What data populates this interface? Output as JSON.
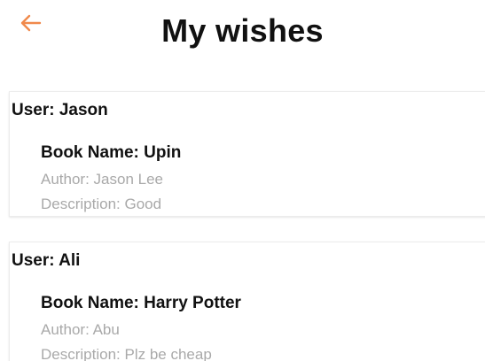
{
  "header": {
    "title": "My wishes",
    "back_icon": "arrow-left-icon",
    "accent_color": "#f0894b"
  },
  "wishes": [
    {
      "user": "User: Jason",
      "book_name": "Book Name: Upin",
      "author": "Author: Jason Lee",
      "description": "Description: Good"
    },
    {
      "user": "User: Ali",
      "book_name": "Book Name: Harry Potter",
      "author": "Author: Abu",
      "description": "Description: Plz be cheap"
    }
  ]
}
